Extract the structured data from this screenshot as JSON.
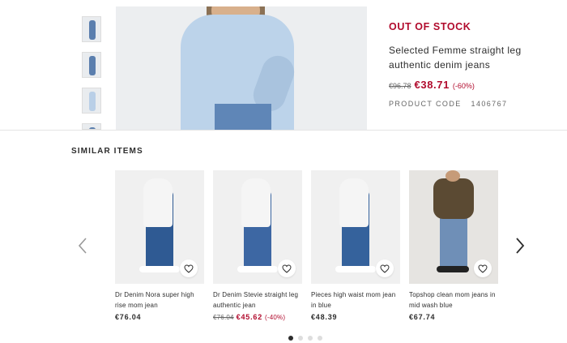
{
  "product": {
    "status": "OUT OF STOCK",
    "title": "Selected Femme straight leg authentic denim jeans",
    "old_price": "€96.78",
    "price": "€38.71",
    "discount": "(-60%)",
    "code_label": "PRODUCT CODE",
    "code": "1406767",
    "thumbnails": [
      "thumb-1",
      "thumb-2",
      "thumb-3",
      "thumb-4"
    ]
  },
  "similar": {
    "title": "SIMILAR ITEMS",
    "items": [
      {
        "name": "Dr Denim Nora super high rise mom jean",
        "price": "€76.04",
        "old_price": "",
        "discount": ""
      },
      {
        "name": "Dr Denim Stevie straight leg authentic jean",
        "price": "€45.62",
        "old_price": "€76.04",
        "discount": "(-40%)"
      },
      {
        "name": "Pieces high waist mom jean in blue",
        "price": "€48.39",
        "old_price": "",
        "discount": ""
      },
      {
        "name": "Topshop clean mom jeans in mid wash blue",
        "price": "€67.74",
        "old_price": "",
        "discount": ""
      }
    ],
    "pagination": {
      "current": 1,
      "total": 4
    }
  },
  "colors": {
    "sale_red": "#b10b2d",
    "text": "#2d2d2d"
  },
  "icons": [
    "heart-icon",
    "chevron-left-icon",
    "chevron-right-icon"
  ]
}
